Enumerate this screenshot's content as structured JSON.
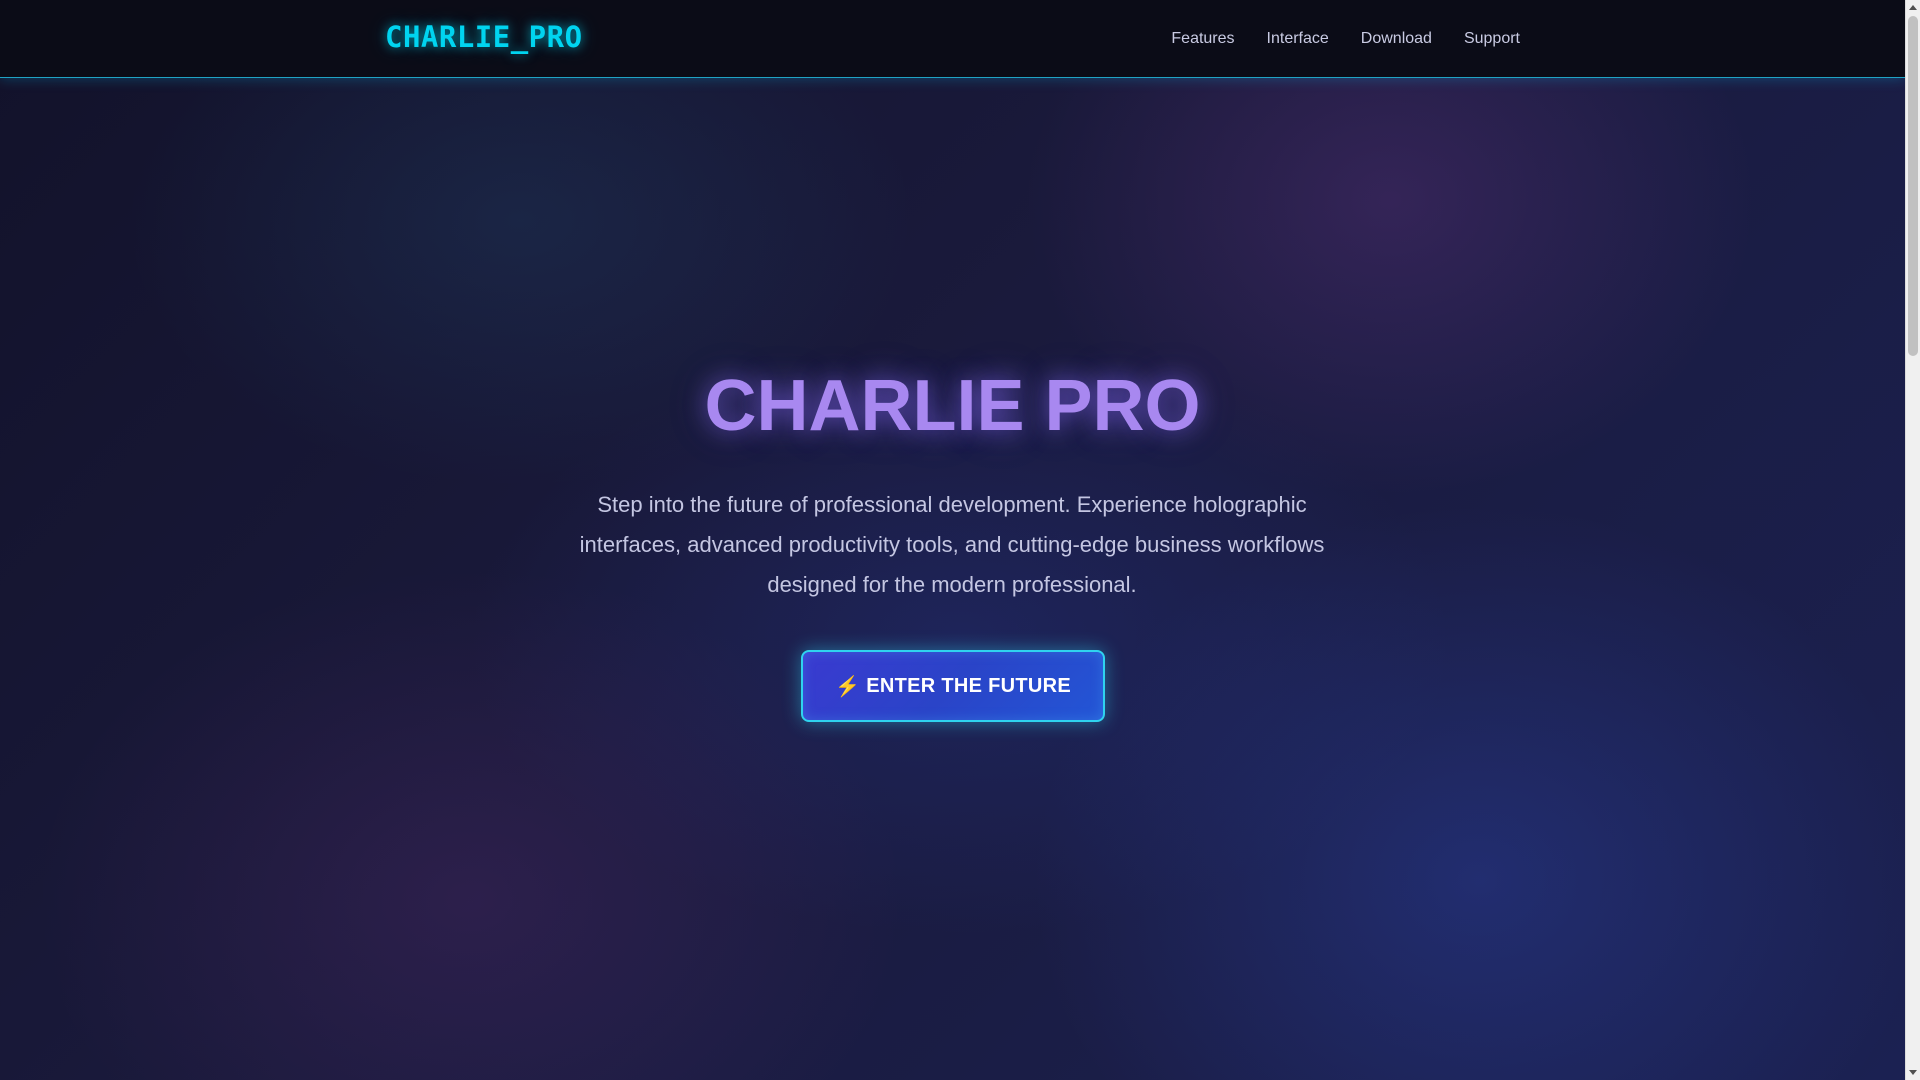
{
  "header": {
    "logo": "CHARLIE_PRO",
    "nav": [
      {
        "label": "Features"
      },
      {
        "label": "Interface"
      },
      {
        "label": "Download"
      },
      {
        "label": "Support"
      }
    ]
  },
  "hero": {
    "title": "CHARLIE PRO",
    "description": "Step into the future of professional development. Experience holographic interfaces, advanced productivity tools, and cutting-edge business workflows designed for the modern professional.",
    "cta_icon": "⚡",
    "cta_label": "ENTER THE FUTURE"
  },
  "colors": {
    "accent_cyan": "#00d4f0",
    "title_purple": "#a888f0",
    "button_blue": "#2a44c8",
    "nav_background": "#0b0c17"
  },
  "icons": {
    "cta": "lightning-bolt-icon"
  }
}
